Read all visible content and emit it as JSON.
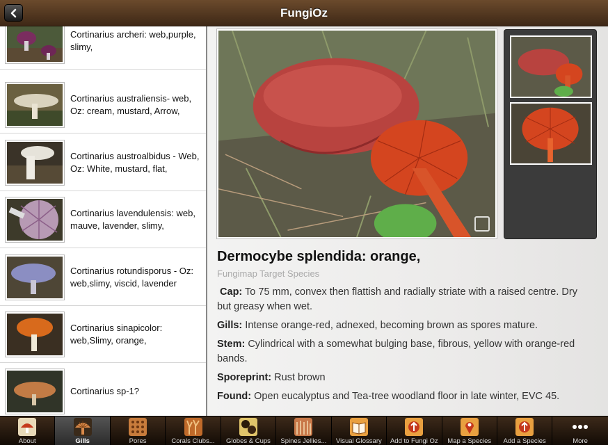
{
  "app": {
    "title": "FungiOz"
  },
  "list": {
    "items": [
      {
        "label": "Cortinarius archeri: web,purple, slimy,",
        "thumb_icon": "purple-mushroom-icon",
        "color": "#7a2d5f"
      },
      {
        "label": "Cortinarius australiensis- web, Oz: cream, mustard, Arrow,",
        "thumb_icon": "cream-mushroom-icon",
        "color": "#d9d2bd"
      },
      {
        "label": "Cortinarius austroalbidus - Web, Oz: White, mustard, flat,",
        "thumb_icon": "white-mushroom-icon",
        "color": "#e6e3da"
      },
      {
        "label": "Cortinarius lavendulensis: web, mauve, lavender, slimy,",
        "thumb_icon": "lavender-mushroom-icon",
        "color": "#b79ab4"
      },
      {
        "label": "Cortinarius rotundisporus - Oz: web,slimy, viscid, lavender",
        "thumb_icon": "blue-lavender-mushroom-icon",
        "color": "#8b8ec2"
      },
      {
        "label": "Cortinarius sinapicolor: web,Slimy, orange,",
        "thumb_icon": "orange-mushroom-icon",
        "color": "#d86a1c"
      },
      {
        "label": "Cortinarius sp-1?",
        "thumb_icon": "brown-mushroom-icon",
        "color": "#c27b45"
      }
    ]
  },
  "detail": {
    "name": "Dermocybe splendida: orange,",
    "subtitle": "Fungimap Target Species",
    "fields": [
      {
        "label": "Cap:",
        "text": "To 75 mm, convex then flattish and radially striate with a raised centre. Dry but greasy when wet."
      },
      {
        "label": "Gills:",
        "text": "Intense orange-red, adnexed, becoming brown as spores mature."
      },
      {
        "label": "Stem:",
        "text": "Cylindrical with a somewhat bulging base, fibrous, yellow with orange-red bands."
      },
      {
        "label": "Sporeprint:",
        "text": "Rust brown"
      },
      {
        "label": "Found:",
        "text": "Open eucalyptus and Tea-tree woodland floor in late winter, EVC 45."
      }
    ]
  },
  "tabs": [
    {
      "label": "About",
      "icon": "about-mushroom-icon",
      "selected": false
    },
    {
      "label": "Gills",
      "icon": "gills-icon",
      "selected": true
    },
    {
      "label": "Pores",
      "icon": "pores-icon",
      "selected": false
    },
    {
      "label": "Corals Clubs...",
      "icon": "corals-icon",
      "selected": false
    },
    {
      "label": "Globes & Cups",
      "icon": "globes-icon",
      "selected": false
    },
    {
      "label": "Spines Jellies...",
      "icon": "spines-icon",
      "selected": false
    },
    {
      "label": "Visual Glossary",
      "icon": "book-icon",
      "selected": false
    },
    {
      "label": "Add to Fungi Oz",
      "icon": "add-fungi-icon",
      "selected": false
    },
    {
      "label": "Map a Species",
      "icon": "map-pin-icon",
      "selected": false
    },
    {
      "label": "Add a Species",
      "icon": "add-species-icon",
      "selected": false
    },
    {
      "label": "More",
      "icon": "more-dots-icon",
      "selected": false
    }
  ],
  "colors": {
    "header": "#4f3520",
    "tabbar": "#2a1b0e",
    "mushroom_cap": "#b8433f",
    "gills": "#d4451f"
  }
}
